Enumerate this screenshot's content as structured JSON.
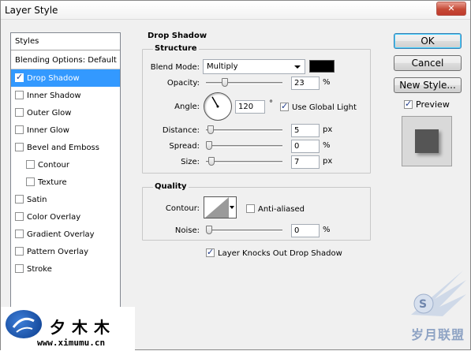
{
  "window": {
    "title": "Layer Style"
  },
  "styles_panel": {
    "header": "Styles",
    "items": [
      {
        "label": "Blending Options: Default",
        "checkbox": false,
        "checked": false,
        "selected": false,
        "indent": false
      },
      {
        "label": "Drop Shadow",
        "checkbox": true,
        "checked": true,
        "selected": true,
        "indent": false
      },
      {
        "label": "Inner Shadow",
        "checkbox": true,
        "checked": false,
        "selected": false,
        "indent": false
      },
      {
        "label": "Outer Glow",
        "checkbox": true,
        "checked": false,
        "selected": false,
        "indent": false
      },
      {
        "label": "Inner Glow",
        "checkbox": true,
        "checked": false,
        "selected": false,
        "indent": false
      },
      {
        "label": "Bevel and Emboss",
        "checkbox": true,
        "checked": false,
        "selected": false,
        "indent": false
      },
      {
        "label": "Contour",
        "checkbox": true,
        "checked": false,
        "selected": false,
        "indent": true
      },
      {
        "label": "Texture",
        "checkbox": true,
        "checked": false,
        "selected": false,
        "indent": true
      },
      {
        "label": "Satin",
        "checkbox": true,
        "checked": false,
        "selected": false,
        "indent": false
      },
      {
        "label": "Color Overlay",
        "checkbox": true,
        "checked": false,
        "selected": false,
        "indent": false
      },
      {
        "label": "Gradient Overlay",
        "checkbox": true,
        "checked": false,
        "selected": false,
        "indent": false
      },
      {
        "label": "Pattern Overlay",
        "checkbox": true,
        "checked": false,
        "selected": false,
        "indent": false
      },
      {
        "label": "Stroke",
        "checkbox": true,
        "checked": false,
        "selected": false,
        "indent": false
      }
    ]
  },
  "drop_shadow": {
    "section_title": "Drop Shadow",
    "structure": {
      "title": "Structure",
      "blend_mode": {
        "label": "Blend Mode:",
        "value": "Multiply",
        "color": "#000000"
      },
      "opacity": {
        "label": "Opacity:",
        "value": "23",
        "unit": "%",
        "level": 0.23
      },
      "angle": {
        "label": "Angle:",
        "value": "120",
        "unit": "°",
        "degrees": 120,
        "use_global_light": "Use Global Light",
        "use_global_light_checked": true
      },
      "distance": {
        "label": "Distance:",
        "value": "5",
        "unit": "px",
        "level": 0.02
      },
      "spread": {
        "label": "Spread:",
        "value": "0",
        "unit": "%",
        "level": 0.0
      },
      "size": {
        "label": "Size:",
        "value": "7",
        "unit": "px",
        "level": 0.03
      }
    },
    "quality": {
      "title": "Quality",
      "contour": {
        "label": "Contour:",
        "anti_aliased": "Anti-aliased",
        "anti_aliased_checked": false
      },
      "noise": {
        "label": "Noise:",
        "value": "0",
        "unit": "%",
        "level": 0.0
      },
      "layer_knocks_out": "Layer Knocks Out Drop Shadow",
      "layer_knocks_out_checked": true
    }
  },
  "buttons": {
    "ok": "OK",
    "cancel": "Cancel",
    "new_style": "New Style..."
  },
  "preview": {
    "label": "Preview",
    "checked": true
  },
  "watermark": {
    "chars": "夕木木",
    "url": "www.ximumu.cn",
    "brand": "岁月联盟"
  }
}
